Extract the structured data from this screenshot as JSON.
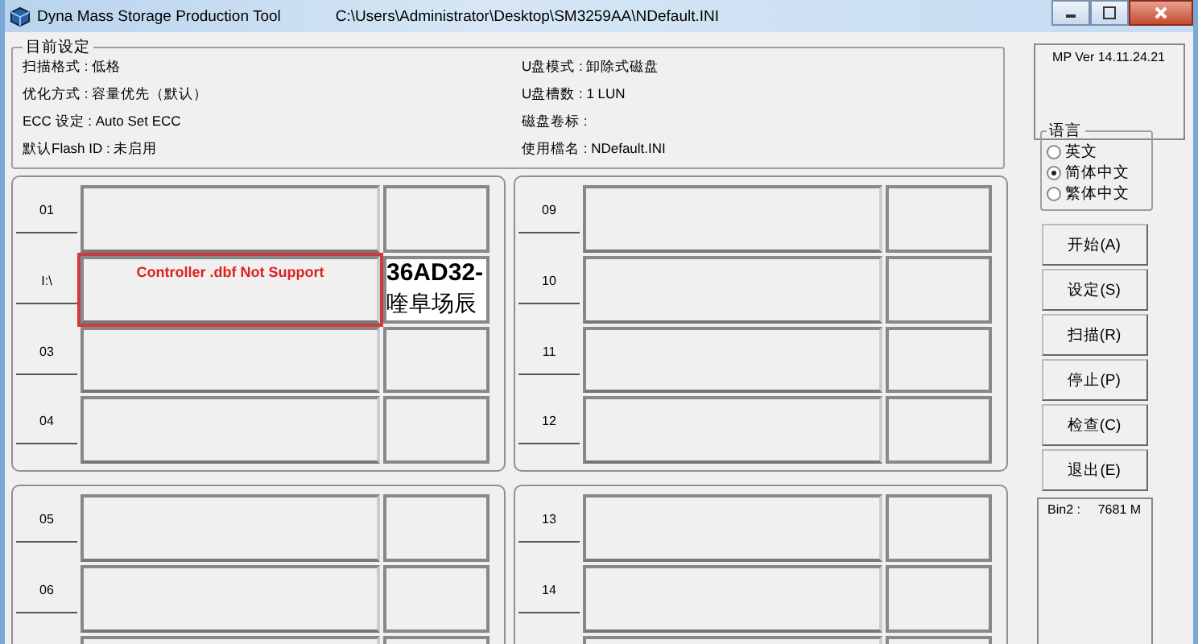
{
  "window": {
    "title": "Dyna Mass Storage Production Tool",
    "path": "C:\\Users\\Administrator\\Desktop\\SM3259AA\\NDefault.INI"
  },
  "settings": {
    "title": "目前设定",
    "items": [
      {
        "text": "扫描格式 : 低格"
      },
      {
        "text": "U盘模式 : 卸除式磁盘"
      },
      {
        "text": "优化方式 : 容量优先（默认）"
      },
      {
        "text": "U盘槽数 : 1 LUN"
      },
      {
        "text": "ECC 设定 : Auto Set ECC"
      },
      {
        "text": "磁盘卷标 :"
      },
      {
        "text": "默认Flash ID : 未启用"
      },
      {
        "text": "使用檔名 : NDefault.INI"
      }
    ]
  },
  "port_groups": [
    {
      "ports": [
        {
          "label": "01",
          "kind": "idle"
        },
        {
          "label": "I:\\",
          "kind": "error",
          "message": "Controller .dbf Not Support",
          "side_lines": [
            "36AD32-",
            "喹阜场辰"
          ]
        },
        {
          "label": "03",
          "kind": "idle"
        },
        {
          "label": "04",
          "kind": "idle"
        }
      ]
    },
    {
      "ports": [
        {
          "label": "09",
          "kind": "idle"
        },
        {
          "label": "10",
          "kind": "idle"
        },
        {
          "label": "11",
          "kind": "idle"
        },
        {
          "label": "12",
          "kind": "idle"
        }
      ]
    },
    {
      "ports": [
        {
          "label": "05",
          "kind": "idle"
        },
        {
          "label": "06",
          "kind": "idle"
        },
        {
          "kind": "idle"
        }
      ]
    },
    {
      "ports": [
        {
          "label": "13",
          "kind": "idle"
        },
        {
          "label": "14",
          "kind": "idle"
        },
        {
          "kind": "idle"
        }
      ]
    }
  ],
  "version": "MP Ver 14.11.24.21",
  "language": {
    "title": "语言",
    "options": [
      {
        "label": "英文",
        "selected": false
      },
      {
        "label": "简体中文",
        "selected": true
      },
      {
        "label": "繁体中文",
        "selected": false
      }
    ]
  },
  "buttons": [
    "开始(A)",
    "设定(S)",
    "扫描(R)",
    "停止(P)",
    "检查(C)",
    "退出(E)"
  ],
  "bin": {
    "label": "Bin2 :",
    "value": "7681 M"
  }
}
